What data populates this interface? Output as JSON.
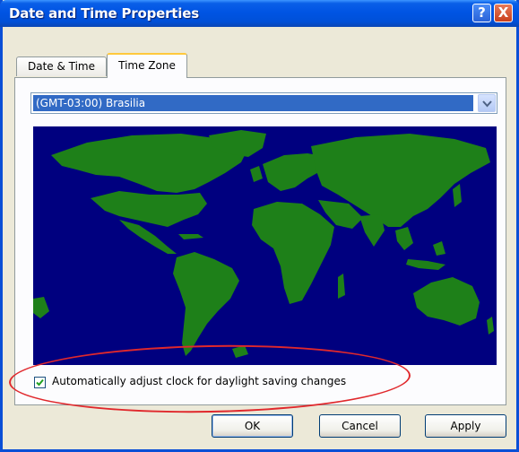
{
  "window": {
    "title": "Date and Time Properties"
  },
  "titlebar_buttons": {
    "help": "?",
    "close": "X"
  },
  "tabs": [
    {
      "label": "Date & Time"
    },
    {
      "label": "Time Zone"
    }
  ],
  "time_zone": {
    "selected": "(GMT-03:00) Brasilia"
  },
  "daylight_saving": {
    "label": "Automatically adjust clock for daylight saving changes",
    "checked": true
  },
  "buttons": {
    "ok": "OK",
    "cancel": "Cancel",
    "apply": "Apply"
  },
  "colors": {
    "map_ocean": "#00007f",
    "map_land": "#1e8019",
    "selection": "#316ac5",
    "annotation": "#e0282c"
  },
  "icons": {
    "dropdown": "chevron-down-icon",
    "checkbox": "checkmark-icon"
  }
}
